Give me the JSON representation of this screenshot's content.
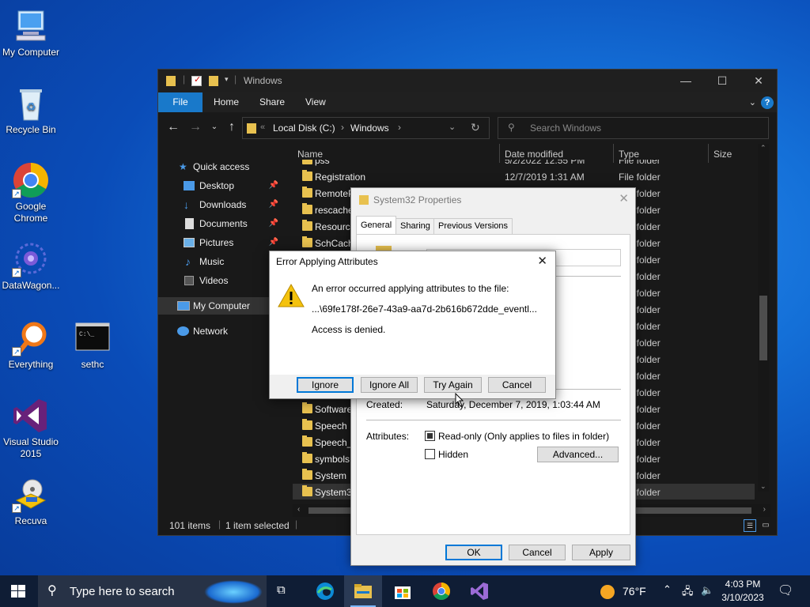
{
  "desktop": {
    "icons": [
      {
        "label": "My Computer"
      },
      {
        "label": "Recycle Bin"
      },
      {
        "label": "Google Chrome"
      },
      {
        "label": "DataWagon..."
      },
      {
        "label": "Everything"
      },
      {
        "label": "sethc"
      },
      {
        "label": "Visual Studio 2015"
      },
      {
        "label": "Recuva"
      }
    ]
  },
  "explorer": {
    "title": "Windows",
    "ribbon_tabs": [
      "File",
      "Home",
      "Share",
      "View"
    ],
    "breadcrumb": [
      "Local Disk (C:)",
      "Windows"
    ],
    "breadcrumb_sep": "›",
    "breadcrumb_overflow": "«",
    "search_placeholder": "Search Windows",
    "sidebar": [
      {
        "label": "Quick access",
        "icon": "star-icon"
      },
      {
        "label": "Desktop",
        "icon": "desktop-icon",
        "pinned": true
      },
      {
        "label": "Downloads",
        "icon": "download-icon",
        "pinned": true
      },
      {
        "label": "Documents",
        "icon": "documents-icon",
        "pinned": true
      },
      {
        "label": "Pictures",
        "icon": "pictures-icon",
        "pinned": true
      },
      {
        "label": "Music",
        "icon": "music-icon"
      },
      {
        "label": "Videos",
        "icon": "videos-icon"
      },
      {
        "label": "My Computer",
        "icon": "computer-icon"
      },
      {
        "label": "Network",
        "icon": "network-icon"
      }
    ],
    "columns": [
      "Name",
      "Date modified",
      "Type",
      "Size"
    ],
    "rows": [
      {
        "name": "pss",
        "date": "5/2/2022 12:55 PM",
        "type": "File folder"
      },
      {
        "name": "Registration",
        "date": "12/7/2019 1:31 AM",
        "type": "File folder"
      },
      {
        "name": "RemoteP",
        "date": "",
        "type": "File folder"
      },
      {
        "name": "rescache",
        "date": "",
        "type": "File folder"
      },
      {
        "name": "Resource",
        "date": "",
        "type": "File folder"
      },
      {
        "name": "SchCach",
        "date": "",
        "type": "File folder"
      },
      {
        "name": "",
        "date": "",
        "type": "File folder"
      },
      {
        "name": "",
        "date": "",
        "type": "File folder"
      },
      {
        "name": "",
        "date": "",
        "type": "File folder"
      },
      {
        "name": "",
        "date": "",
        "type": "File folder"
      },
      {
        "name": "",
        "date": "",
        "type": "File folder"
      },
      {
        "name": "",
        "date": "",
        "type": "File folder"
      },
      {
        "name": "",
        "date": "",
        "type": "File folder"
      },
      {
        "name": "",
        "date": "",
        "type": "File folder"
      },
      {
        "name": "",
        "date": "",
        "type": "File folder"
      },
      {
        "name": "Software",
        "date": "",
        "type": "File folder"
      },
      {
        "name": "Speech",
        "date": "",
        "type": "File folder"
      },
      {
        "name": "Speech_C",
        "date": "",
        "type": "File folder"
      },
      {
        "name": "symbols",
        "date": "",
        "type": "File folder"
      },
      {
        "name": "System",
        "date": "",
        "type": "File folder"
      },
      {
        "name": "System32",
        "date": "",
        "type": "File folder"
      }
    ],
    "status_items": "101 items",
    "status_selected": "1 item selected"
  },
  "properties": {
    "title": "System32 Properties",
    "tabs": [
      "General",
      "Sharing",
      "Previous Versions"
    ],
    "created_label": "Created:",
    "created_value": "Saturday, December 7, 2019, 1:03:44 AM",
    "attributes_label": "Attributes:",
    "readonly_label": "Read-only (Only applies to files in folder)",
    "readonly_state": "indeterminate",
    "hidden_label": "Hidden",
    "advanced_label": "Advanced...",
    "ok_label": "OK",
    "cancel_label": "Cancel",
    "apply_label": "Apply"
  },
  "error": {
    "title": "Error Applying Attributes",
    "message": "An error occurred applying attributes to the file:",
    "path": "...\\69fe178f-26e7-43a9-aa7d-2b616b672dde_eventl...",
    "detail": "Access is denied.",
    "ignore_label": "Ignore",
    "ignore_all_label": "Ignore All",
    "try_again_label": "Try Again",
    "cancel_label": "Cancel"
  },
  "taskbar": {
    "search_placeholder": "Type here to search",
    "weather": "76°F",
    "time": "4:03 PM",
    "date": "3/10/2023"
  },
  "colors": {
    "accent": "#1979ca",
    "warning": "#f4c20d",
    "desktop": "#1470d8"
  }
}
